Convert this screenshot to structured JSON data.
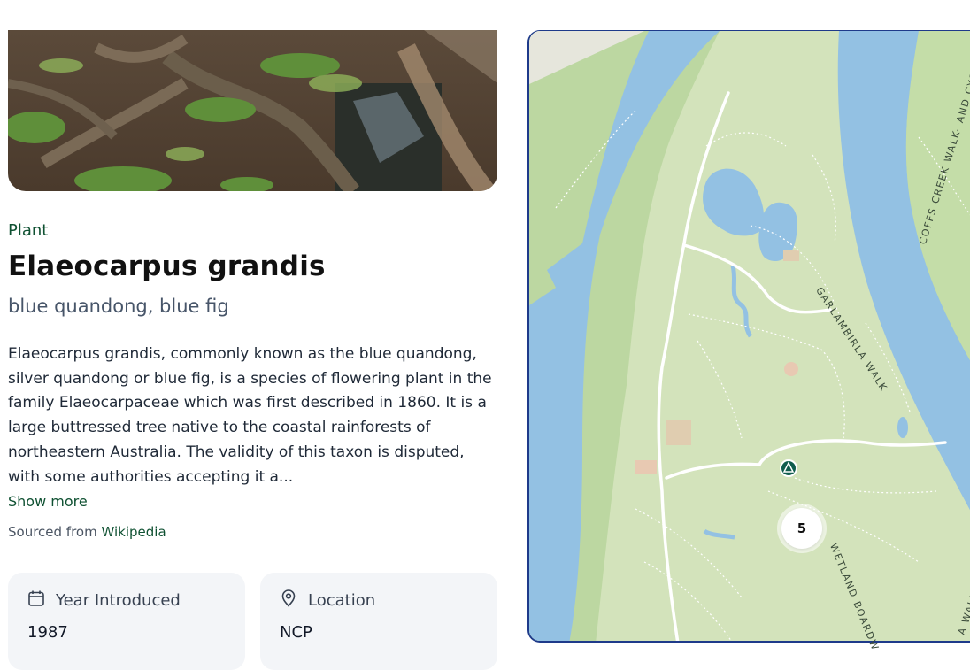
{
  "plant": {
    "category": "Plant",
    "scientific_name": "Elaeocarpus grandis",
    "common_names": "blue quandong, blue fig",
    "description": "Elaeocarpus grandis, commonly known as the blue quandong, silver quandong or blue fig, is a species of flowering plant in the family Elaeocarpaceae which was first described in 1860. It is a large buttressed tree native to the coastal rainforests of northeastern Australia. The validity of this taxon is disputed, with some authorities accepting it a...",
    "show_more_label": "Show more",
    "sourced_prefix": "Sourced from",
    "source_link": "Wikipedia"
  },
  "cards": [
    {
      "icon": "calendar-icon",
      "label": "Year Introduced",
      "value": "1987"
    },
    {
      "icon": "location-pin-icon",
      "label": "Location",
      "value": "NCP"
    }
  ],
  "map": {
    "cluster_count": "5",
    "marker_icon": "campsite-icon",
    "labels": {
      "garlambirla": "GARLAMBIRLA WALK",
      "coffs_creek": "COFFS CREEK WALK- AND CYCLEWAY",
      "wetland": "WETLAND BOARDW",
      "edge": "A WALK"
    },
    "colors": {
      "water": "#93c1e3",
      "park": "#d3e3bb",
      "land_dark": "#bcd7a1",
      "path": "#ffffff",
      "marker": "#0f5c4d"
    }
  }
}
